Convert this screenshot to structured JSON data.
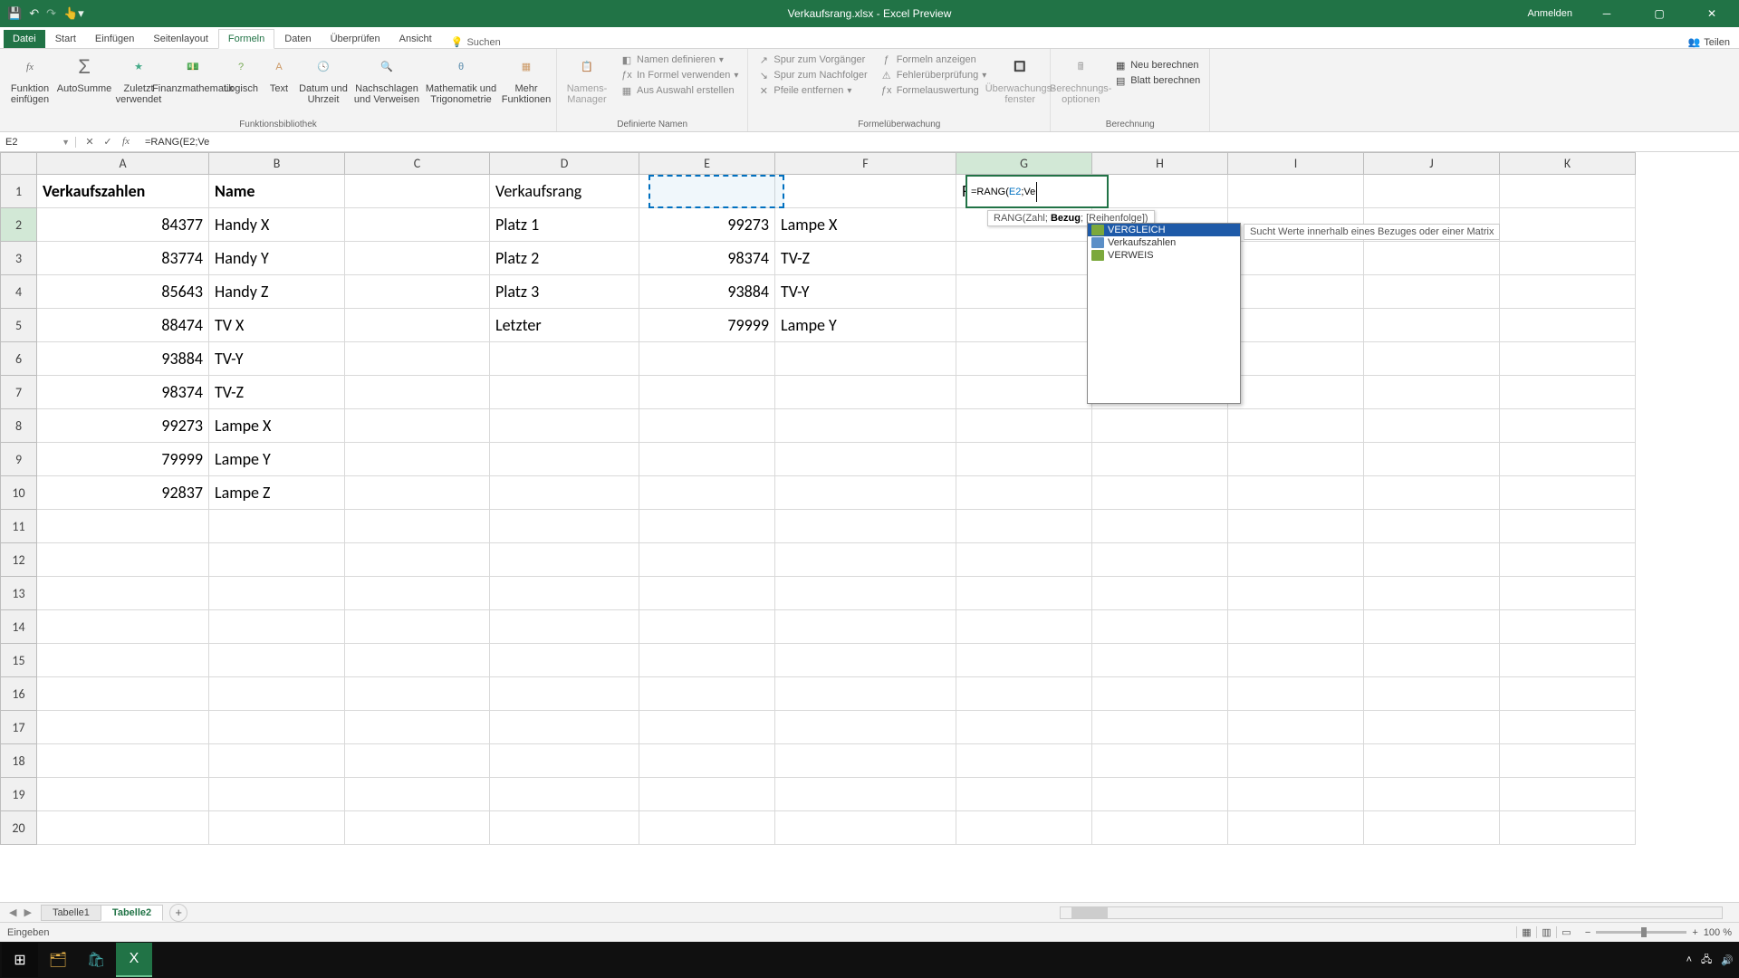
{
  "titlebar": {
    "title": "Verkaufsrang.xlsx - Excel Preview",
    "signin": "Anmelden"
  },
  "tabs": {
    "file": "Datei",
    "list": [
      "Start",
      "Einfügen",
      "Seitenlayout",
      "Formeln",
      "Daten",
      "Überprüfen",
      "Ansicht"
    ],
    "active": "Formeln",
    "search": "Suchen",
    "share": "Teilen"
  },
  "ribbon": {
    "lib": {
      "label": "Funktionsbibliothek",
      "insertfn": "Funktion\neinfügen",
      "autosum": "AutoSumme",
      "recent": "Zuletzt\nverwendet",
      "fin": "Finanzmathematik",
      "logic": "Logisch",
      "text": "Text",
      "date": "Datum und\nUhrzeit",
      "lookup": "Nachschlagen\nund Verweisen",
      "math": "Mathematik und\nTrigonometrie",
      "more": "Mehr\nFunktionen"
    },
    "names": {
      "label": "Definierte Namen",
      "mgr": "Namens-\nManager",
      "def": "Namen definieren",
      "usefm": "In Formel verwenden",
      "createsel": "Aus Auswahl erstellen"
    },
    "audit": {
      "label": "Formelüberwachung",
      "prec": "Spur zum Vorgänger",
      "dep": "Spur zum Nachfolger",
      "rem": "Pfeile entfernen",
      "show": "Formeln anzeigen",
      "check": "Fehlerüberprüfung",
      "eval": "Formelauswertung",
      "watch": "Überwachungs-\nfenster"
    },
    "calc": {
      "label": "Berechnung",
      "opts": "Berechnungs-\noptionen",
      "now": "Neu berechnen",
      "sheet": "Blatt berechnen"
    }
  },
  "formulabar": {
    "name": "E2",
    "formula": "=RANG(E2;Ve"
  },
  "columns": [
    "A",
    "B",
    "C",
    "D",
    "E",
    "F",
    "G",
    "H",
    "I",
    "J",
    "K"
  ],
  "rows": 20,
  "data": {
    "A1": "Verkaufszahlen",
    "B1": "Name",
    "D1": "Verkaufsrang",
    "G1": "Rang",
    "A2": "84377",
    "B2": "Handy X",
    "D2": "Platz 1",
    "E2": "99273",
    "F2": "Lampe X",
    "G2": "=RANG(E2;Ve",
    "A3": "83774",
    "B3": "Handy Y",
    "D3": "Platz 2",
    "E3": "98374",
    "F3": "TV-Z",
    "A4": "85643",
    "B4": "Handy Z",
    "D4": "Platz 3",
    "E4": "93884",
    "F4": "TV-Y",
    "A5": "88474",
    "B5": "TV X",
    "D5": "Letzter",
    "E5": "79999",
    "F5": "Lampe Y",
    "A6": "93884",
    "B6": "TV-Y",
    "A7": "98374",
    "B7": "TV-Z",
    "A8": "99273",
    "B8": "Lampe X",
    "A9": "79999",
    "B9": "Lampe Y",
    "A10": "92837",
    "B10": "Lampe Z"
  },
  "editing": {
    "cell": "G2",
    "tooltip_fn": "RANG(",
    "tooltip_p1": "Zahl; ",
    "tooltip_bold": "Bezug",
    "tooltip_rest": "; [Reihenfolge])"
  },
  "autocomplete": {
    "items": [
      {
        "label": "VERGLEICH",
        "type": "fn",
        "sel": true
      },
      {
        "label": "Verkaufszahlen",
        "type": "tbl"
      },
      {
        "label": "VERWEIS",
        "type": "fn"
      }
    ],
    "desc": "Sucht Werte innerhalb eines Bezuges oder einer Matrix"
  },
  "sheets": {
    "list": [
      "Tabelle1",
      "Tabelle2"
    ],
    "active": "Tabelle2"
  },
  "status": {
    "mode": "Eingeben",
    "zoom": "100 %"
  }
}
